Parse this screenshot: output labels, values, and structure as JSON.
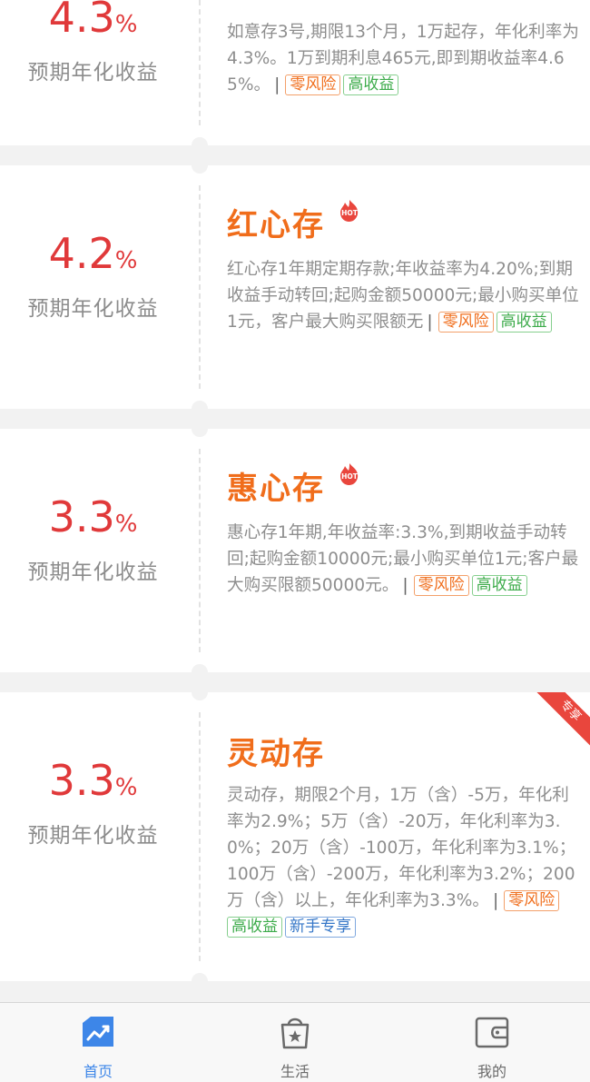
{
  "rate_label": "预期年化收益",
  "cards": [
    {
      "rate": "4.3",
      "pct": "%",
      "title": "",
      "hot": false,
      "desc": "如意存3号,期限13个月，1万起存，年化利率为4.3%。1万到期利息465元,即到期收益率4.65%。",
      "separator": "|",
      "tags": [
        "零风险",
        "高收益"
      ]
    },
    {
      "rate": "4.2",
      "pct": "%",
      "title": "红心存",
      "hot": true,
      "hot_label": "HOT",
      "desc": "红心存1年期定期存款;年收益率为4.20%;到期收益手动转回;起购金额50000元;最小购买单位1元，客户最大购买限额无",
      "separator": "|",
      "tags": [
        "零风险",
        "高收益"
      ]
    },
    {
      "rate": "3.3",
      "pct": "%",
      "title": "惠心存",
      "hot": true,
      "hot_label": "HOT",
      "desc": "惠心存1年期,年收益率:3.3%,到期收益手动转回;起购金额10000元;最小购买单位1元;客户最大购买限额50000元。",
      "separator": "|",
      "tags": [
        "零风险",
        "高收益"
      ]
    },
    {
      "rate": "3.3",
      "pct": "%",
      "title": "灵动存",
      "hot": false,
      "ribbon": "专享",
      "desc": "灵动存，期限2个月，1万（含）-5万，年化利率为2.9%；5万（含）-20万，年化利率为3.0%；20万（含）-100万，年化利率为3.1%；100万（含）-200万，年化利率为3.2%；200万（含）以上，年化利率为3.3%。",
      "separator": "|",
      "tags": [
        "零风险",
        "高收益",
        "新手专享"
      ]
    }
  ],
  "tabbar": {
    "home": "首页",
    "life": "生活",
    "mine": "我的"
  },
  "colors": {
    "rate": "#e0393a",
    "title": "#f06d1b",
    "tab_active": "#3d86e8"
  }
}
